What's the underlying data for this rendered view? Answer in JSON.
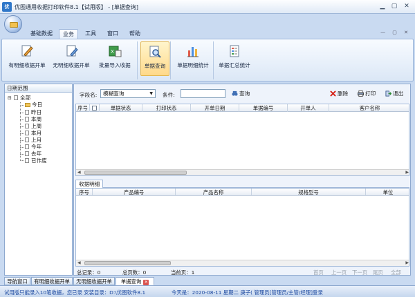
{
  "window": {
    "app_icon_text": "优",
    "title": "优图通用收据打印软件8.1【试用版】 - [单据查询]"
  },
  "menu": [
    "基础数据",
    "业务",
    "工具",
    "窗口",
    "帮助"
  ],
  "ribbon": {
    "buttons": [
      "有明细收据开单",
      "无明细收据开单",
      "批量导入收据",
      "单据查询",
      "单据明细统计",
      "单据汇总统计"
    ]
  },
  "left_panel": {
    "tab_title": "日期范围",
    "root": "全部",
    "items": [
      "今日",
      "昨日",
      "本周",
      "上周",
      "本月",
      "上月",
      "今年",
      "去年",
      "已作废"
    ]
  },
  "toolbar": {
    "field_label": "字段名:",
    "field_value": "模糊查询",
    "condition_label": "条件:",
    "condition_value": "",
    "query_label": "查询",
    "delete_label": "删除",
    "print_label": "打印",
    "exit_label": "退出"
  },
  "top_grid": {
    "columns": [
      "序号",
      "",
      "单据状态",
      "打印状态",
      "开单日期",
      "单据编号",
      "开单人",
      "客户名称"
    ]
  },
  "detail_tab": "收据明细",
  "bottom_grid": {
    "columns": [
      "序号",
      "产品编号",
      "产品名称",
      "规格型号",
      "单位"
    ]
  },
  "footer": {
    "total_records": "总记录：0",
    "total_pages": "总页数：0",
    "current_page": "当前页：1",
    "nav": [
      "首页",
      "上一页",
      "下一页",
      "尾页",
      "全部"
    ]
  },
  "bottom_tabs": [
    "导航窗口",
    "有明细收据开单",
    "无明细收据开单",
    "单据查询"
  ],
  "status": {
    "left": "试用版只能录入10笔收据，您已录   安装目录：D:\\优图软件8.1",
    "right": "今天是：2020-08-11 星期二 庚子(   管理员[管理员/主管/经理]登录"
  },
  "colors": {
    "accent": "#2f77c9",
    "selected": "#ffd98a"
  }
}
